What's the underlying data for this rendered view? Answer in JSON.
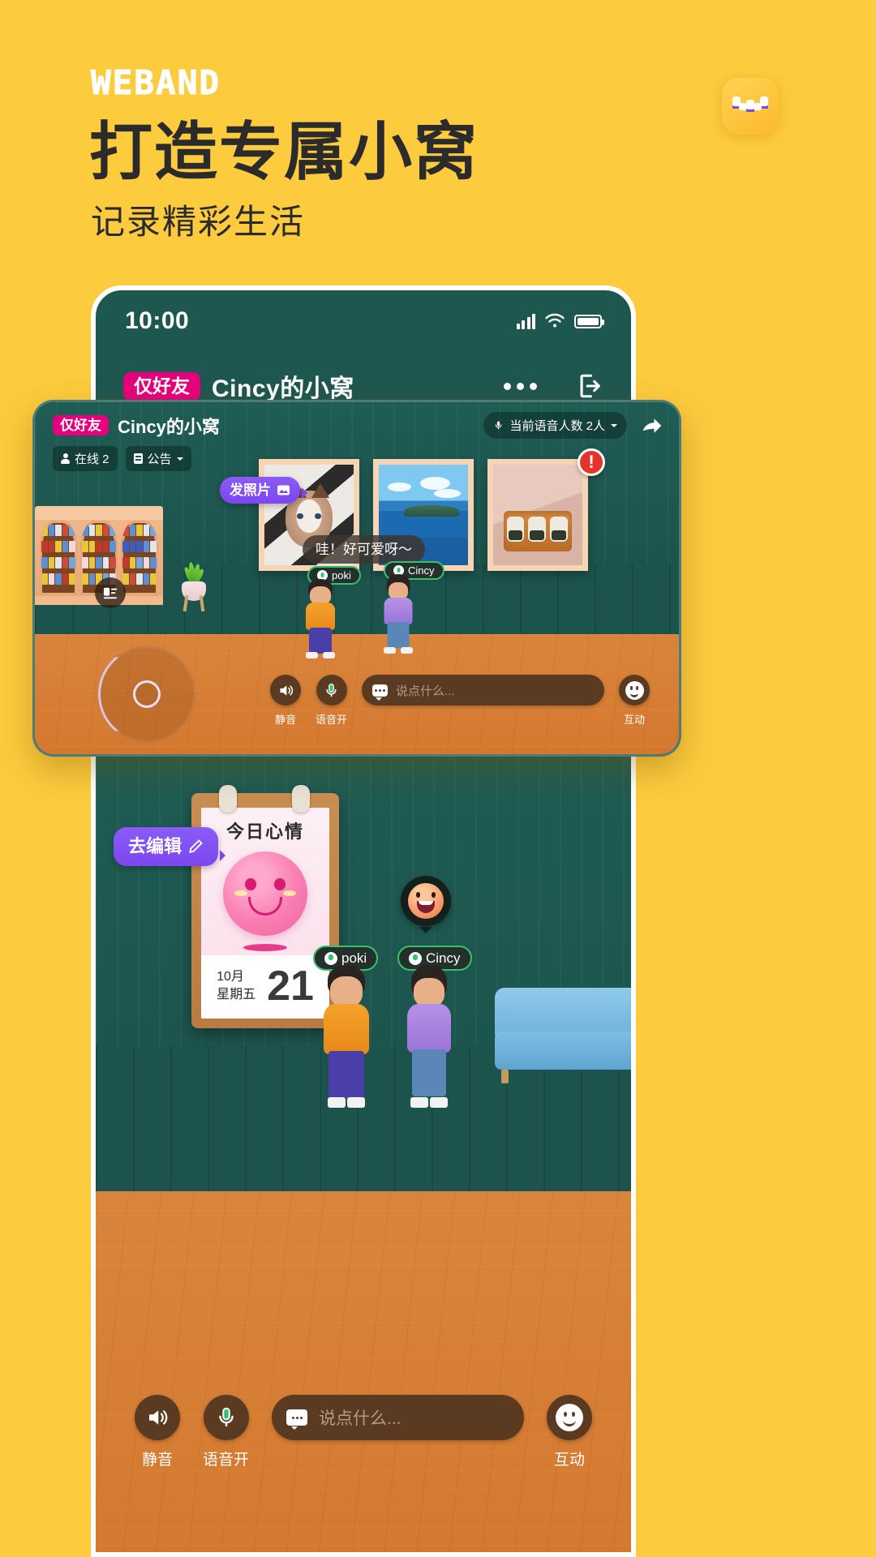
{
  "promo": {
    "logo": "WEBAND",
    "headline": "打造专属小窝",
    "subhead": "记录精彩生活",
    "app_icon_name": "weband-app-icon",
    "bg_color": "#FDCB3E",
    "headline_color": "#2B2B2B"
  },
  "phone": {
    "statusbar": {
      "time": "10:00",
      "signal_icon": "cellular-signal-icon",
      "wifi_icon": "wifi-icon",
      "battery_icon": "battery-full-icon"
    },
    "header": {
      "badge": "仅好友",
      "title": "Cincy的小窝",
      "more_icon": "more-dots-icon",
      "exit_icon": "exit-room-icon"
    }
  },
  "overlay": {
    "badge": "仅好友",
    "title": "Cincy的小窝",
    "online_chip": "在线 2",
    "notice_chip": "公告",
    "voice_chip": "当前语音人数 2人",
    "share_icon": "share-arrow-icon",
    "photo_tip": "发照片",
    "photo_tip_icon": "image-icon",
    "chat_message": "哇！好可爱呀～",
    "warning_badge": "!",
    "nametags": [
      "poki",
      "Cincy"
    ],
    "photos": [
      {
        "name": "cat-photo",
        "alt": "ragdoll cat"
      },
      {
        "name": "sea-photo",
        "alt": "ocean island view"
      },
      {
        "name": "food-photo",
        "alt": "onigiri in tray"
      }
    ],
    "joystick_name": "movement-joystick",
    "toolbar": {
      "mute_label": "静音",
      "mute_icon": "speaker-icon",
      "voice_label": "语音开",
      "voice_icon": "microphone-icon",
      "input_placeholder": "说点什么...",
      "input_icon": "message-icon",
      "interact_label": "互动",
      "interact_icon": "smiley-icon"
    }
  },
  "room2": {
    "edit_tip": "去编辑",
    "edit_tip_icon": "pencil-icon",
    "mood_title": "今日心情",
    "mood_face_icon": "pink-smile-face",
    "date_month": "10月",
    "date_weekday": "星期五",
    "date_day": "21",
    "emoji_bubble_icon": "laughing-emoji",
    "nametags": [
      "poki",
      "Cincy"
    ],
    "sofa_name": "blue-sofa",
    "toolbar": {
      "mute_label": "静音",
      "mute_icon": "speaker-icon",
      "voice_label": "语音开",
      "voice_icon": "microphone-icon",
      "input_placeholder": "说点什么...",
      "input_icon": "message-icon",
      "interact_label": "互动",
      "interact_icon": "smiley-icon"
    }
  },
  "colors": {
    "brand_yellow": "#FDCB3E",
    "wall_green": "#1E5750",
    "floor_orange": "#D9843C",
    "accent_magenta": "#E6007E",
    "accent_purple": "#7C46F0",
    "mic_green": "#3BBF6A"
  }
}
